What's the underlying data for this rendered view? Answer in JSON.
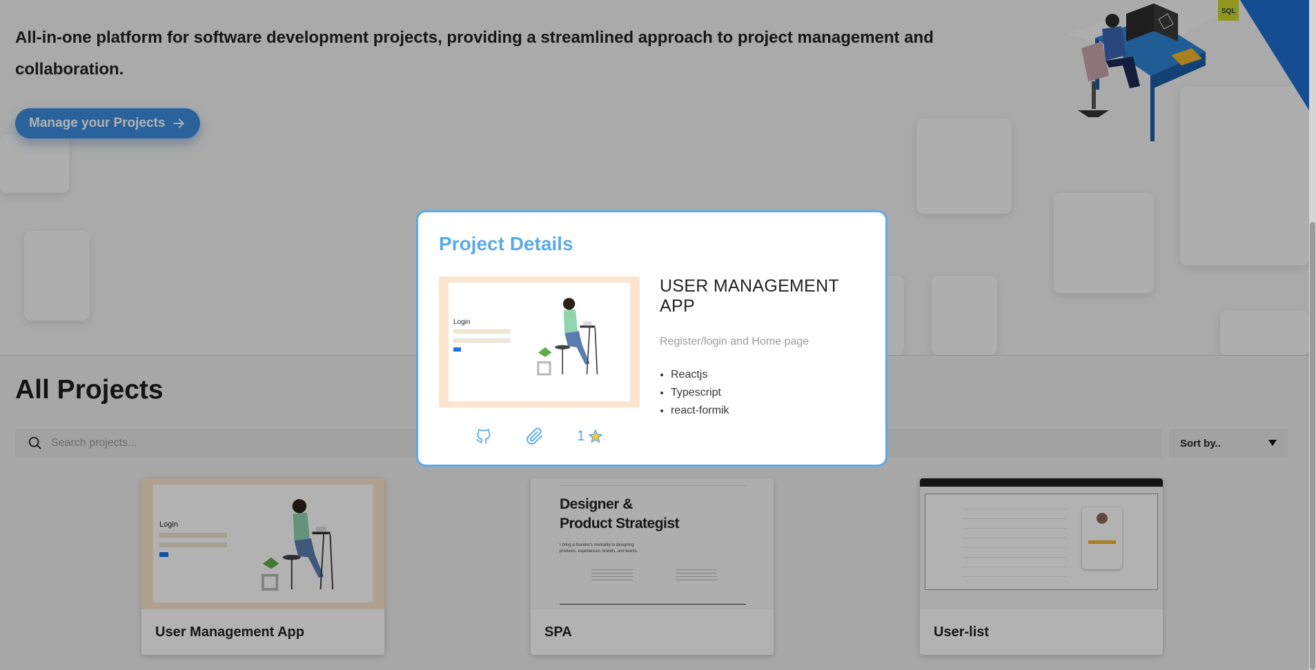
{
  "hero": {
    "tagline": "All-in-one platform for software development projects, providing a streamlined approach to project management and collaboration.",
    "cta_label": "Manage your Projects",
    "badge": "SQL"
  },
  "projects": {
    "title": "All Projects",
    "search_placeholder": "Search projects...",
    "sort_label": "Sort by..",
    "cards": [
      {
        "label": "User Management App"
      },
      {
        "label": "SPA"
      },
      {
        "label": "User-list"
      }
    ],
    "spa_thumb": {
      "headline_1": "Designer &",
      "headline_2": "Product Strategist",
      "sub": "I bring a founder's mentality to designing products, experiences, brands, and teams."
    },
    "login_thumb": {
      "title": "Login"
    }
  },
  "modal": {
    "title": "Project Details",
    "project_name": "USER MANAGEMENT APP",
    "description": "Register/login and Home page",
    "technologies": [
      "Reactjs",
      "Typescript",
      "react-formik"
    ],
    "stars": "1",
    "icons": [
      "github-icon",
      "paperclip-icon",
      "star-icon"
    ]
  },
  "colors": {
    "accent": "#5aaae8",
    "cta": "#3d8fe0"
  }
}
